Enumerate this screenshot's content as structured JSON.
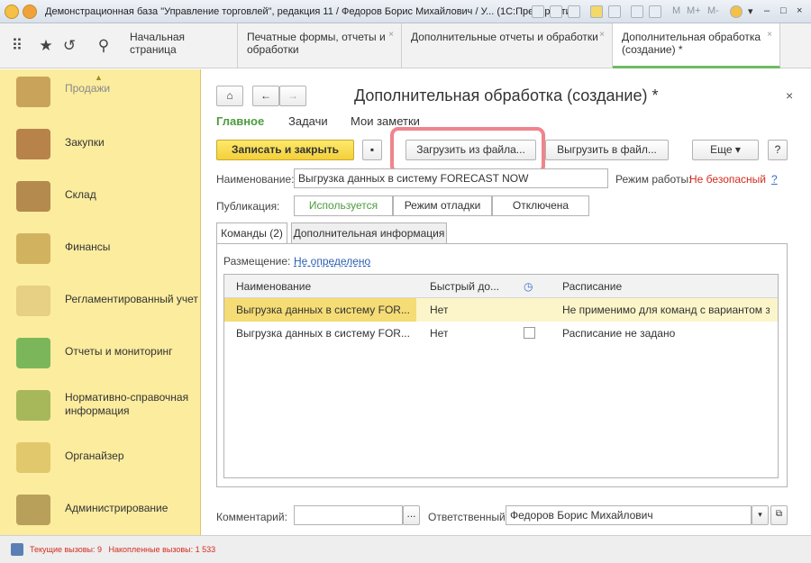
{
  "window": {
    "title": "Демонстрационная база \"Управление торговлей\", редакция 11 / Федоров Борис Михайлович / У... (1С:Предприятие)"
  },
  "titlebar_labels": [
    "M",
    "M+",
    "M-"
  ],
  "tabs": [
    {
      "label": "Начальная страница"
    },
    {
      "label": "Печатные формы, отчеты и обработки"
    },
    {
      "label": "Дополнительные отчеты и обработки"
    },
    {
      "label": "Дополнительная обработка (создание) *"
    }
  ],
  "sidebar": {
    "items": [
      {
        "label": "Продажи"
      },
      {
        "label": "Закупки"
      },
      {
        "label": "Склад"
      },
      {
        "label": "Финансы"
      },
      {
        "label": "Регламентированный учет"
      },
      {
        "label": "Отчеты и мониторинг"
      },
      {
        "label": "Нормативно-справочная информация"
      },
      {
        "label": "Органайзер"
      },
      {
        "label": "Администрирование"
      }
    ]
  },
  "form": {
    "title": "Дополнительная обработка (создание) *",
    "nav": [
      "Главное",
      "Задачи",
      "Мои заметки"
    ],
    "save_close": "Записать и закрыть",
    "load_file": "Загрузить из файла...",
    "unload_file": "Выгрузить в файл...",
    "more": "Еще",
    "help": "?",
    "name_label": "Наименование:",
    "name_value": "Выгрузка данных в систему FORECAST NOW",
    "mode_label": "Режим работы:",
    "mode_value": "Не безопасный",
    "mode_help": "?",
    "publication_label": "Публикация:",
    "publication_options": [
      "Используется",
      "Режим отладки",
      "Отключена"
    ],
    "inner_tabs": [
      "Команды (2)",
      "Дополнительная информация"
    ],
    "placement_label": "Размещение:",
    "placement_value": "Не определено",
    "columns": [
      "Наименование",
      "Быстрый до...",
      "Расписание"
    ],
    "rows": [
      {
        "name": "Выгрузка данных в систему FOR...",
        "fast": "Нет",
        "schedule": "Не применимо для команд с вариантом з..."
      },
      {
        "name": "Выгрузка данных в систему FOR...",
        "fast": "Нет",
        "schedule": "Расписание не задано"
      }
    ],
    "comment_label": "Комментарий:",
    "comment_value": "",
    "responsible_label": "Ответственный:",
    "responsible_value": "Федоров Борис Михайлович"
  },
  "status": {
    "text": "Текущие вызовы: 9   Накопленные вызовы: 1 533"
  },
  "colors": {
    "accent": "#4d9c3f",
    "highlight": "#fbf5c9",
    "danger": "#d52b1e",
    "callout": "#f0848c",
    "sidebar": "#fbec9e"
  }
}
